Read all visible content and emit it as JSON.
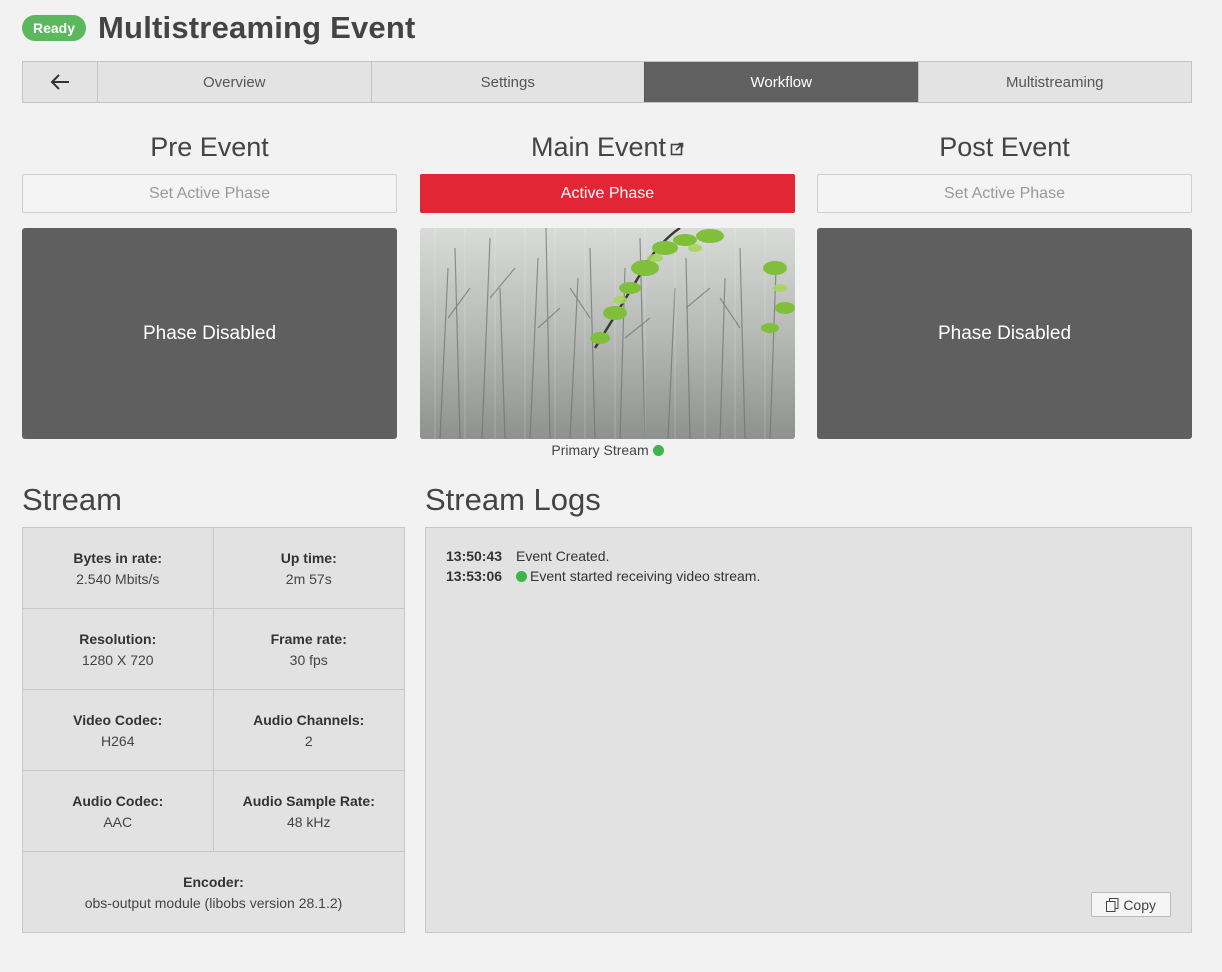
{
  "header": {
    "status_badge": "Ready",
    "title": "Multistreaming Event"
  },
  "tabs": [
    {
      "label": "Overview"
    },
    {
      "label": "Settings"
    },
    {
      "label": "Workflow",
      "active": true
    },
    {
      "label": "Multistreaming"
    }
  ],
  "phases": {
    "pre": {
      "title": "Pre Event",
      "button": "Set Active Phase",
      "status": "Phase Disabled"
    },
    "main": {
      "title": "Main Event",
      "button": "Active Phase",
      "stream_label": "Primary Stream"
    },
    "post": {
      "title": "Post Event",
      "button": "Set Active Phase",
      "status": "Phase Disabled"
    }
  },
  "stream": {
    "title": "Stream",
    "stats": [
      {
        "label": "Bytes in rate:",
        "value": "2.540 Mbits/s"
      },
      {
        "label": "Up time:",
        "value": "2m 57s"
      },
      {
        "label": "Resolution:",
        "value": "1280 X 720"
      },
      {
        "label": "Frame rate:",
        "value": "30 fps"
      },
      {
        "label": "Video Codec:",
        "value": "H264"
      },
      {
        "label": "Audio Channels:",
        "value": "2"
      },
      {
        "label": "Audio Codec:",
        "value": "AAC"
      },
      {
        "label": "Audio Sample Rate:",
        "value": "48 kHz"
      }
    ],
    "encoder": {
      "label": "Encoder:",
      "value": "obs-output module (libobs version 28.1.2)"
    }
  },
  "logs": {
    "title": "Stream Logs",
    "entries": [
      {
        "time": "13:50:43",
        "message": "Event Created."
      },
      {
        "time": "13:53:06",
        "message": "Event started receiving video stream."
      }
    ],
    "copy_label": "Copy"
  },
  "colors": {
    "ready_badge": "#5cb85c",
    "active_phase": "#e32636",
    "active_tab": "#616161",
    "status_ok": "#3cb54a"
  }
}
